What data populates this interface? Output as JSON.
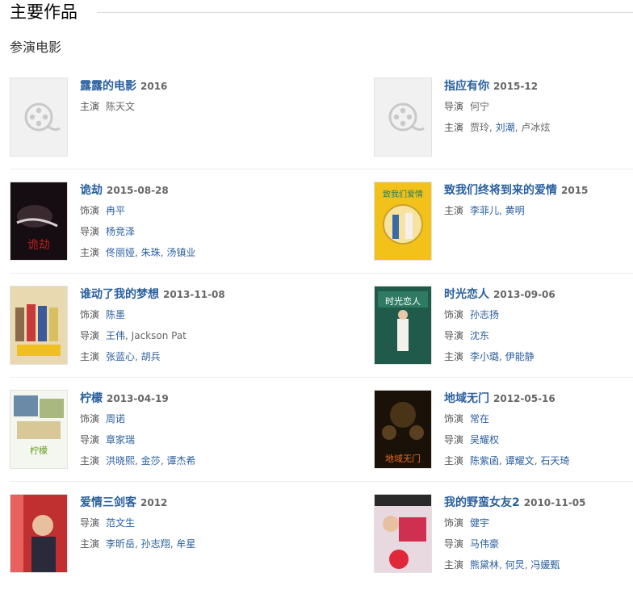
{
  "section_title": "主要作品",
  "subsection_title": "参演电影",
  "films": [
    {
      "title": "露露的电影",
      "date": "2016",
      "poster": "placeholder",
      "credits": [
        {
          "role": "主演",
          "people": [
            "陈天文"
          ],
          "linked": false
        }
      ]
    },
    {
      "title": "指应有你",
      "date": "2015-12",
      "poster": "placeholder",
      "credits": [
        {
          "role": "导演",
          "people": [
            "何宁"
          ],
          "linked": false
        },
        {
          "role": "主演",
          "people": [
            "贾玲",
            "刘潮",
            "卢冰炫"
          ],
          "linked": [
            false,
            true,
            false
          ]
        }
      ]
    },
    {
      "title": "诡劫",
      "date": "2015-08-28",
      "poster": "dark-horror",
      "credits": [
        {
          "role": "饰演",
          "people": [
            "冉平"
          ],
          "linked": true
        },
        {
          "role": "导演",
          "people": [
            "杨竞泽"
          ],
          "linked": true
        },
        {
          "role": "主演",
          "people": [
            "佟丽娅",
            "朱珠",
            "汤镇业"
          ],
          "linked": true
        }
      ]
    },
    {
      "title": "致我们终将到来的爱情",
      "date": "2015",
      "poster": "yellow-love",
      "credits": [
        {
          "role": "主演",
          "people": [
            "李菲儿",
            "黄明"
          ],
          "linked": true
        }
      ]
    },
    {
      "title": "谁动了我的梦想",
      "date": "2013-11-08",
      "poster": "comedy-cast",
      "credits": [
        {
          "role": "饰演",
          "people": [
            "陈墨"
          ],
          "linked": true
        },
        {
          "role": "导演",
          "people": [
            "王伟",
            "Jackson Pat"
          ],
          "linked": [
            true,
            false
          ]
        },
        {
          "role": "主演",
          "people": [
            "张蓝心",
            "胡兵"
          ],
          "linked": true
        }
      ]
    },
    {
      "title": "时光恋人",
      "date": "2013-09-06",
      "poster": "school-green",
      "credits": [
        {
          "role": "饰演",
          "people": [
            "孙志扬"
          ],
          "linked": true
        },
        {
          "role": "导演",
          "people": [
            "沈东"
          ],
          "linked": true
        },
        {
          "role": "主演",
          "people": [
            "李小璐",
            "伊能静"
          ],
          "linked": true
        }
      ]
    },
    {
      "title": "柠檬",
      "date": "2013-04-19",
      "poster": "lemon-collage",
      "credits": [
        {
          "role": "饰演",
          "people": [
            "周诺"
          ],
          "linked": true
        },
        {
          "role": "导演",
          "people": [
            "章家瑞"
          ],
          "linked": true
        },
        {
          "role": "主演",
          "people": [
            "洪晓熙",
            "金莎",
            "谭杰希"
          ],
          "linked": true
        }
      ]
    },
    {
      "title": "地域无门",
      "date": "2012-05-16",
      "poster": "dark-crowd",
      "credits": [
        {
          "role": "饰演",
          "people": [
            "常在"
          ],
          "linked": true
        },
        {
          "role": "导演",
          "people": [
            "吴耀权"
          ],
          "linked": true
        },
        {
          "role": "主演",
          "people": [
            "陈紫函",
            "谭耀文",
            "石天琦"
          ],
          "linked": true
        }
      ]
    },
    {
      "title": "爱情三剑客",
      "date": "2012",
      "poster": "red-portrait",
      "credits": [
        {
          "role": "导演",
          "people": [
            "范文生"
          ],
          "linked": true
        },
        {
          "role": "主演",
          "people": [
            "李昕岳",
            "孙志翔",
            "牟星"
          ],
          "linked": true
        }
      ]
    },
    {
      "title": "我的野蛮女友2",
      "date": "2010-11-05",
      "poster": "pink-comedy",
      "credits": [
        {
          "role": "饰演",
          "people": [
            "健宇"
          ],
          "linked": true
        },
        {
          "role": "导演",
          "people": [
            "马伟豪"
          ],
          "linked": true
        },
        {
          "role": "主演",
          "people": [
            "熊黛林",
            "何炅",
            "冯媛甄"
          ],
          "linked": true
        }
      ]
    }
  ]
}
